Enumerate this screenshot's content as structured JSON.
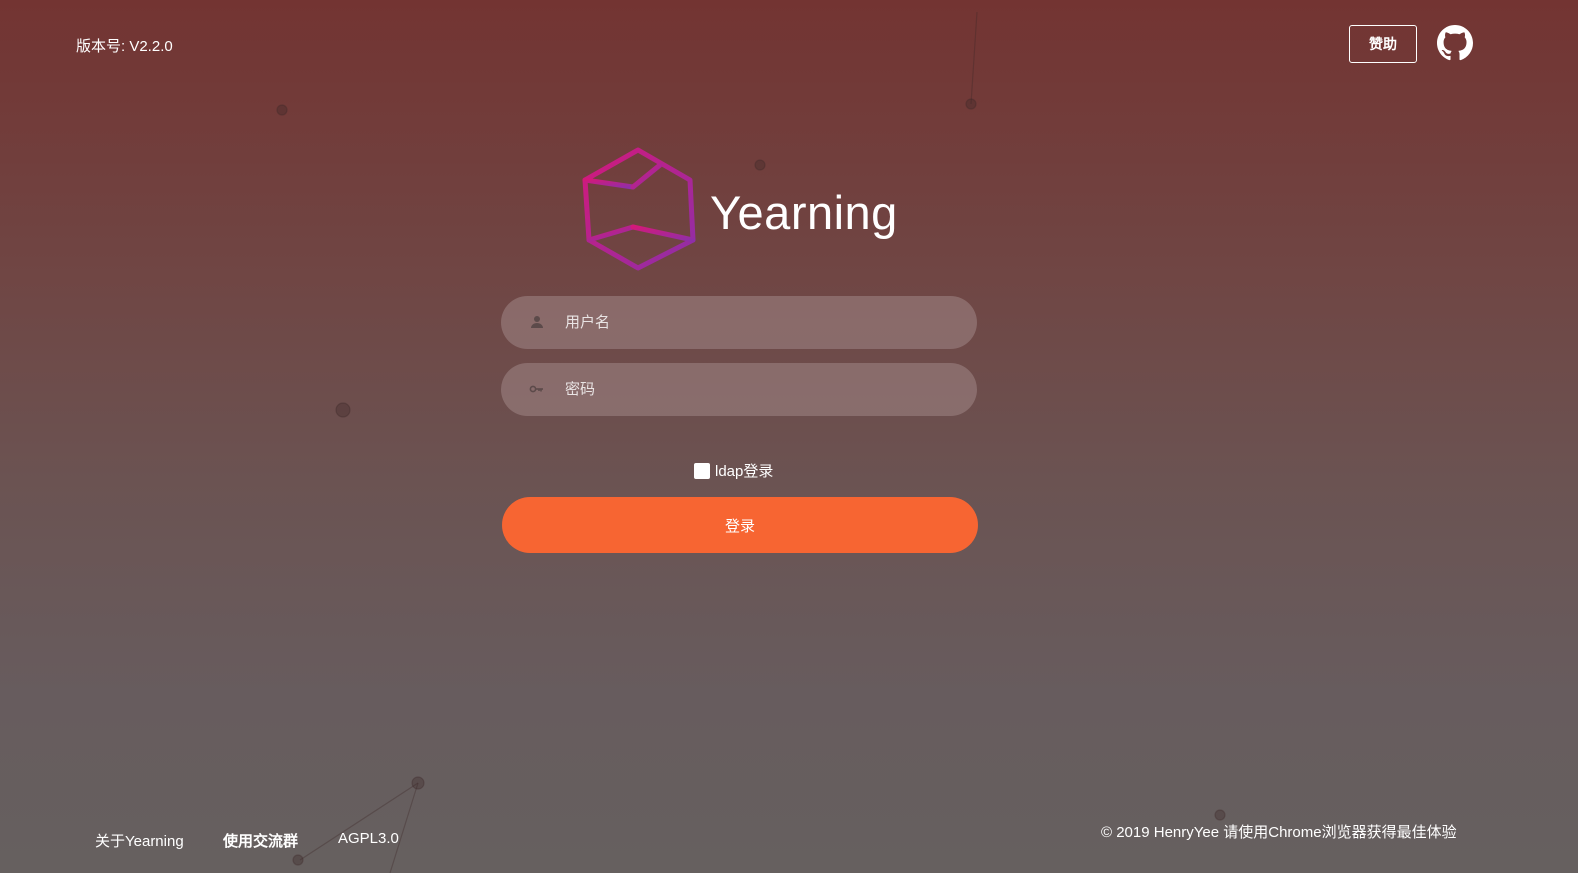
{
  "header": {
    "version": "版本号: V2.2.0",
    "donate_label": "赞助"
  },
  "brand": {
    "name": "Yearning"
  },
  "form": {
    "username_placeholder": "用户名",
    "password_placeholder": "密码",
    "ldap_label": "ldap登录",
    "login_label": "登录"
  },
  "footer": {
    "links": [
      "关于Yearning",
      "使用交流群",
      "AGPL3.0"
    ],
    "copyright": "© 2019 HenryYee 请使用Chrome浏览器获得最佳体验"
  },
  "icons": {
    "github": "github-icon",
    "user": "user-icon",
    "key": "key-icon",
    "logo": "hexagon-cube-logo"
  },
  "colors": {
    "accent": "#f76532",
    "logo_start": "#d4197a",
    "logo_end": "#8e2fa8"
  }
}
